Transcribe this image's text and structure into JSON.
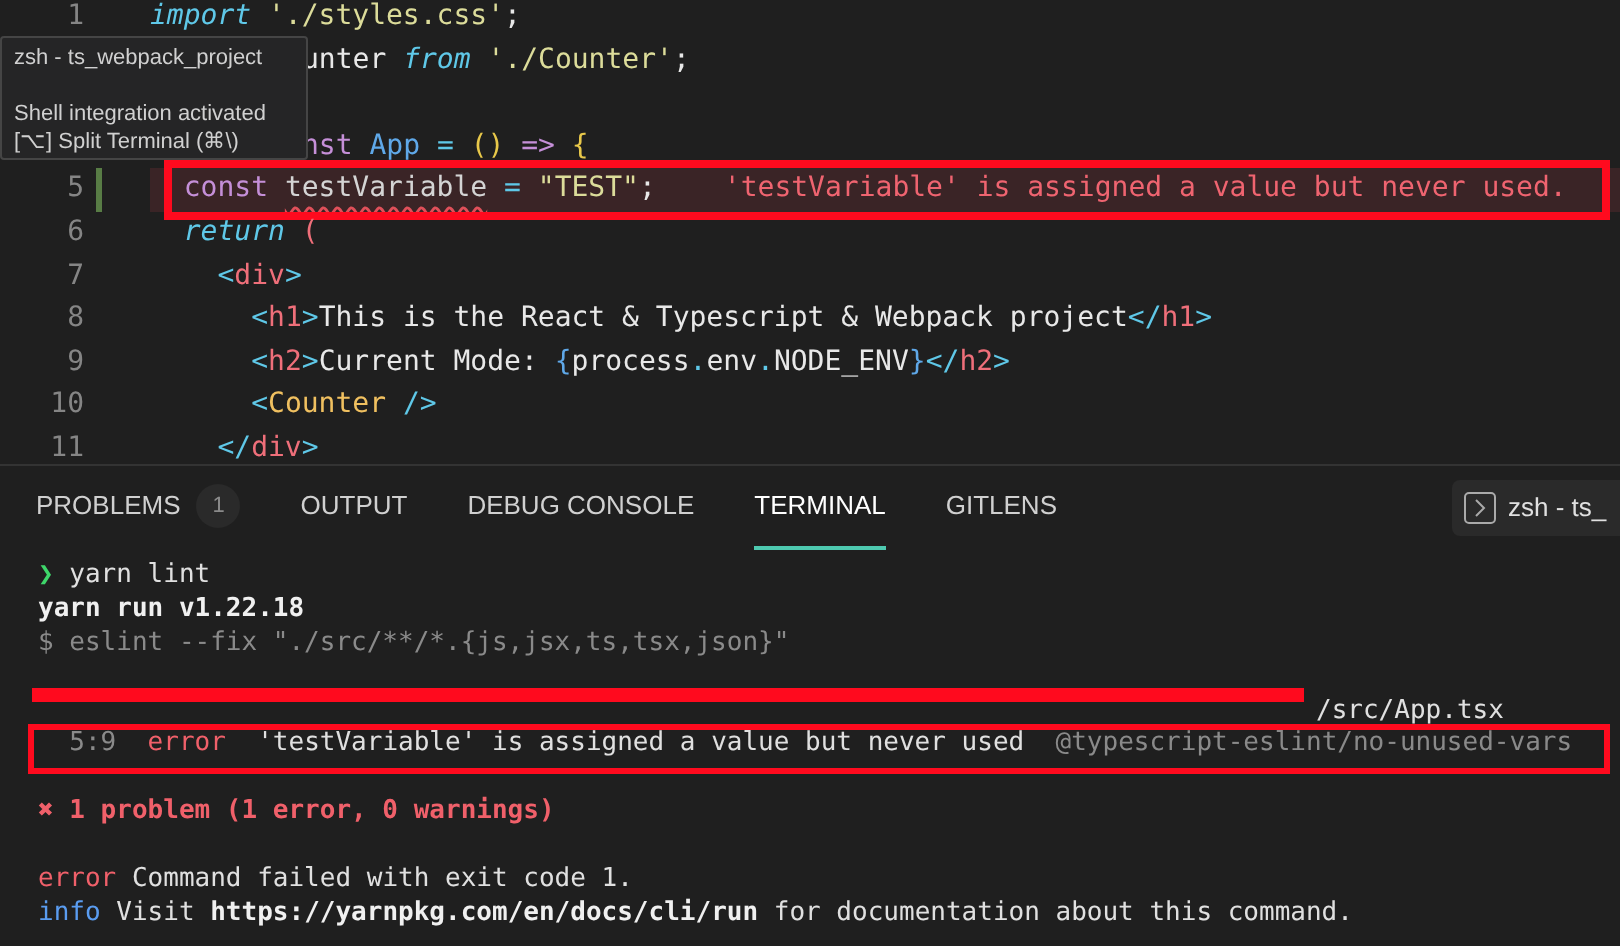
{
  "editor": {
    "lines": [
      {
        "number": "1",
        "covered": false,
        "blank_before": false,
        "tokens": [
          {
            "text": "import",
            "kind": "keyword"
          },
          {
            "text": " './styles.css'",
            "kind": "string"
          },
          {
            "text": ";",
            "kind": "plain"
          }
        ]
      },
      {
        "covered": true,
        "blank_before": false,
        "tokens": [
          {
            "text": "unter ",
            "kind": "plain"
          },
          {
            "text": "from",
            "kind": "keyword"
          },
          {
            "text": " './Counter'",
            "kind": "string"
          },
          {
            "text": ";",
            "kind": "plain"
          }
        ]
      },
      {
        "covered": true,
        "blank_before": true,
        "tokens": [
          {
            "text": "nst ",
            "kind": "storage"
          },
          {
            "text": "App",
            "kind": "func"
          },
          {
            "text": " = ",
            "kind": "operator"
          },
          {
            "text": "()",
            "kind": "bracket"
          },
          {
            "text": " => ",
            "kind": "storage"
          },
          {
            "text": "{",
            "kind": "bracket"
          }
        ]
      },
      {
        "number": "5",
        "covered": false,
        "blank_before": false,
        "error": true,
        "message": "'testVariable' is assigned a value but never used.",
        "tokens": [
          {
            "text": "  const ",
            "kind": "storage"
          },
          {
            "text": "testVariable",
            "kind": "var",
            "squiggle": true
          },
          {
            "text": " = ",
            "kind": "operator"
          },
          {
            "text": "\"TEST\"",
            "kind": "string"
          },
          {
            "text": ";",
            "kind": "plain"
          }
        ]
      },
      {
        "number": "6",
        "covered": false,
        "blank_before": false,
        "tokens": [
          {
            "text": "  return",
            "kind": "keyword"
          },
          {
            "text": " (",
            "kind": "tag"
          }
        ]
      },
      {
        "number": "7",
        "covered": false,
        "blank_before": false,
        "tokens": [
          {
            "text": "    <",
            "kind": "operator"
          },
          {
            "text": "div",
            "kind": "tag"
          },
          {
            "text": ">",
            "kind": "operator"
          }
        ]
      },
      {
        "number": "8",
        "covered": false,
        "blank_before": false,
        "tokens": [
          {
            "text": "      <",
            "kind": "operator"
          },
          {
            "text": "h1",
            "kind": "tag"
          },
          {
            "text": ">",
            "kind": "operator"
          },
          {
            "text": "This is the React & Typescript & Webpack project",
            "kind": "plain"
          },
          {
            "text": "</",
            "kind": "operator"
          },
          {
            "text": "h1",
            "kind": "tag"
          },
          {
            "text": ">",
            "kind": "operator"
          }
        ]
      },
      {
        "number": "9",
        "covered": false,
        "blank_before": false,
        "tokens": [
          {
            "text": "      <",
            "kind": "operator"
          },
          {
            "text": "h2",
            "kind": "tag"
          },
          {
            "text": ">",
            "kind": "operator"
          },
          {
            "text": "Current Mode: ",
            "kind": "plain"
          },
          {
            "text": "{",
            "kind": "func"
          },
          {
            "text": "process",
            "kind": "plain"
          },
          {
            "text": ".",
            "kind": "operator"
          },
          {
            "text": "env",
            "kind": "plain"
          },
          {
            "text": ".",
            "kind": "operator"
          },
          {
            "text": "NODE_ENV",
            "kind": "plain"
          },
          {
            "text": "}",
            "kind": "func"
          },
          {
            "text": "</",
            "kind": "operator"
          },
          {
            "text": "h2",
            "kind": "tag"
          },
          {
            "text": ">",
            "kind": "operator"
          }
        ]
      },
      {
        "number": "10",
        "covered": false,
        "blank_before": false,
        "tokens": [
          {
            "text": "      <",
            "kind": "operator"
          },
          {
            "text": "Counter",
            "kind": "component"
          },
          {
            "text": " />",
            "kind": "operator"
          }
        ]
      },
      {
        "number": "11",
        "covered": false,
        "blank_before": false,
        "tokens": [
          {
            "text": "    </",
            "kind": "operator"
          },
          {
            "text": "div",
            "kind": "tag"
          },
          {
            "text": ">",
            "kind": "operator"
          }
        ]
      }
    ]
  },
  "tooltip": {
    "title": "zsh - ts_webpack_project",
    "lines": [
      "Shell integration activated",
      "[⌥] Split Terminal (⌘\\)"
    ]
  },
  "panel": {
    "tabs": [
      {
        "label": "PROBLEMS",
        "badge": "1",
        "selected": false
      },
      {
        "label": "OUTPUT",
        "selected": false
      },
      {
        "label": "DEBUG CONSOLE",
        "selected": false
      },
      {
        "label": "TERMINAL",
        "selected": true
      },
      {
        "label": "GITLENS",
        "selected": false
      }
    ],
    "terminal_chip": "zsh - ts_"
  },
  "terminal": {
    "lines": [
      {
        "kind": "output",
        "tokens": [
          {
            "text": "❯",
            "kind": "prompt"
          },
          {
            "text": " yarn lint",
            "kind": "plain"
          }
        ]
      },
      {
        "kind": "output",
        "tokens": [
          {
            "text": "yarn run v1.22.18",
            "kind": "bold"
          }
        ]
      },
      {
        "kind": "output",
        "tokens": [
          {
            "text": "$ eslint --fix \"./src/**/*.{js,jsx,ts,tsx,json}\"",
            "kind": "dim"
          }
        ]
      },
      {
        "kind": "blank"
      },
      {
        "kind": "output",
        "tokens": [
          {
            "kind": "redacted"
          },
          {
            "text": "/src/App.tsx",
            "kind": "plain"
          }
        ]
      },
      {
        "kind": "output",
        "boxed": true,
        "tokens": [
          {
            "text": "  5:9",
            "kind": "dim"
          },
          {
            "text": "  error",
            "kind": "error"
          },
          {
            "text": "  'testVariable' is assigned a value but never used",
            "kind": "plain"
          },
          {
            "text": "  @typescript-eslint/no-unused-vars",
            "kind": "dim"
          }
        ]
      },
      {
        "kind": "blank"
      },
      {
        "kind": "output",
        "tokens": [
          {
            "text": "✖ 1 problem (1 error, 0 warnings)",
            "kind": "errorbold"
          }
        ]
      },
      {
        "kind": "blank"
      },
      {
        "kind": "output",
        "tokens": [
          {
            "text": "error",
            "kind": "error"
          },
          {
            "text": " Command failed with exit code 1.",
            "kind": "plain"
          }
        ]
      },
      {
        "kind": "output",
        "tokens": [
          {
            "text": "info",
            "kind": "info"
          },
          {
            "text": " Visit ",
            "kind": "plain"
          },
          {
            "text": "https://yarnpkg.com/en/docs/cli/run",
            "kind": "bold"
          },
          {
            "text": " for documentation about this command.",
            "kind": "plain"
          }
        ]
      }
    ]
  }
}
